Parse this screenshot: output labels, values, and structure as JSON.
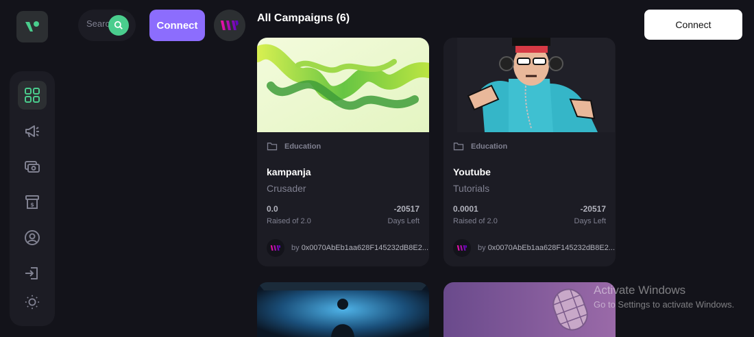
{
  "search": {
    "placeholder": "Search"
  },
  "header": {
    "connect_label": "Connect",
    "wallet_connect_label": "Connect"
  },
  "page": {
    "title": "All Campaigns (6)"
  },
  "sidebar": {
    "items": [
      {
        "name": "dashboard",
        "icon": "dashboard-icon",
        "active": true
      },
      {
        "name": "campaign",
        "icon": "megaphone-icon"
      },
      {
        "name": "payment",
        "icon": "payment-icon"
      },
      {
        "name": "withdraw",
        "icon": "withdraw-icon"
      },
      {
        "name": "profile",
        "icon": "profile-icon"
      },
      {
        "name": "logout",
        "icon": "logout-icon"
      }
    ],
    "theme_icon": "sun-icon"
  },
  "campaigns": [
    {
      "category": "Education",
      "title": "kampanja",
      "subtitle": "Crusader",
      "raised": "0.0",
      "raised_label": "Raised of 2.0",
      "days": "-20517",
      "days_label": "Days Left",
      "owner_prefix": "by",
      "owner": "0x0070AbEb1aa628F145232dB8E2..."
    },
    {
      "category": "Education",
      "title": "Youtube",
      "subtitle": "Tutorials",
      "raised": "0.0001",
      "raised_label": "Raised of 2.0",
      "days": "-20517",
      "days_label": "Days Left",
      "owner_prefix": "by",
      "owner": "0x0070AbEb1aa628F145232dB8E2..."
    }
  ],
  "watermark": {
    "line1": "Activate Windows",
    "line2": "Go to Settings to activate Windows."
  },
  "colors": {
    "bg": "#13131a",
    "panel": "#1c1c24",
    "accent_green": "#4acd8d",
    "accent_purple": "#8c6dfd"
  }
}
